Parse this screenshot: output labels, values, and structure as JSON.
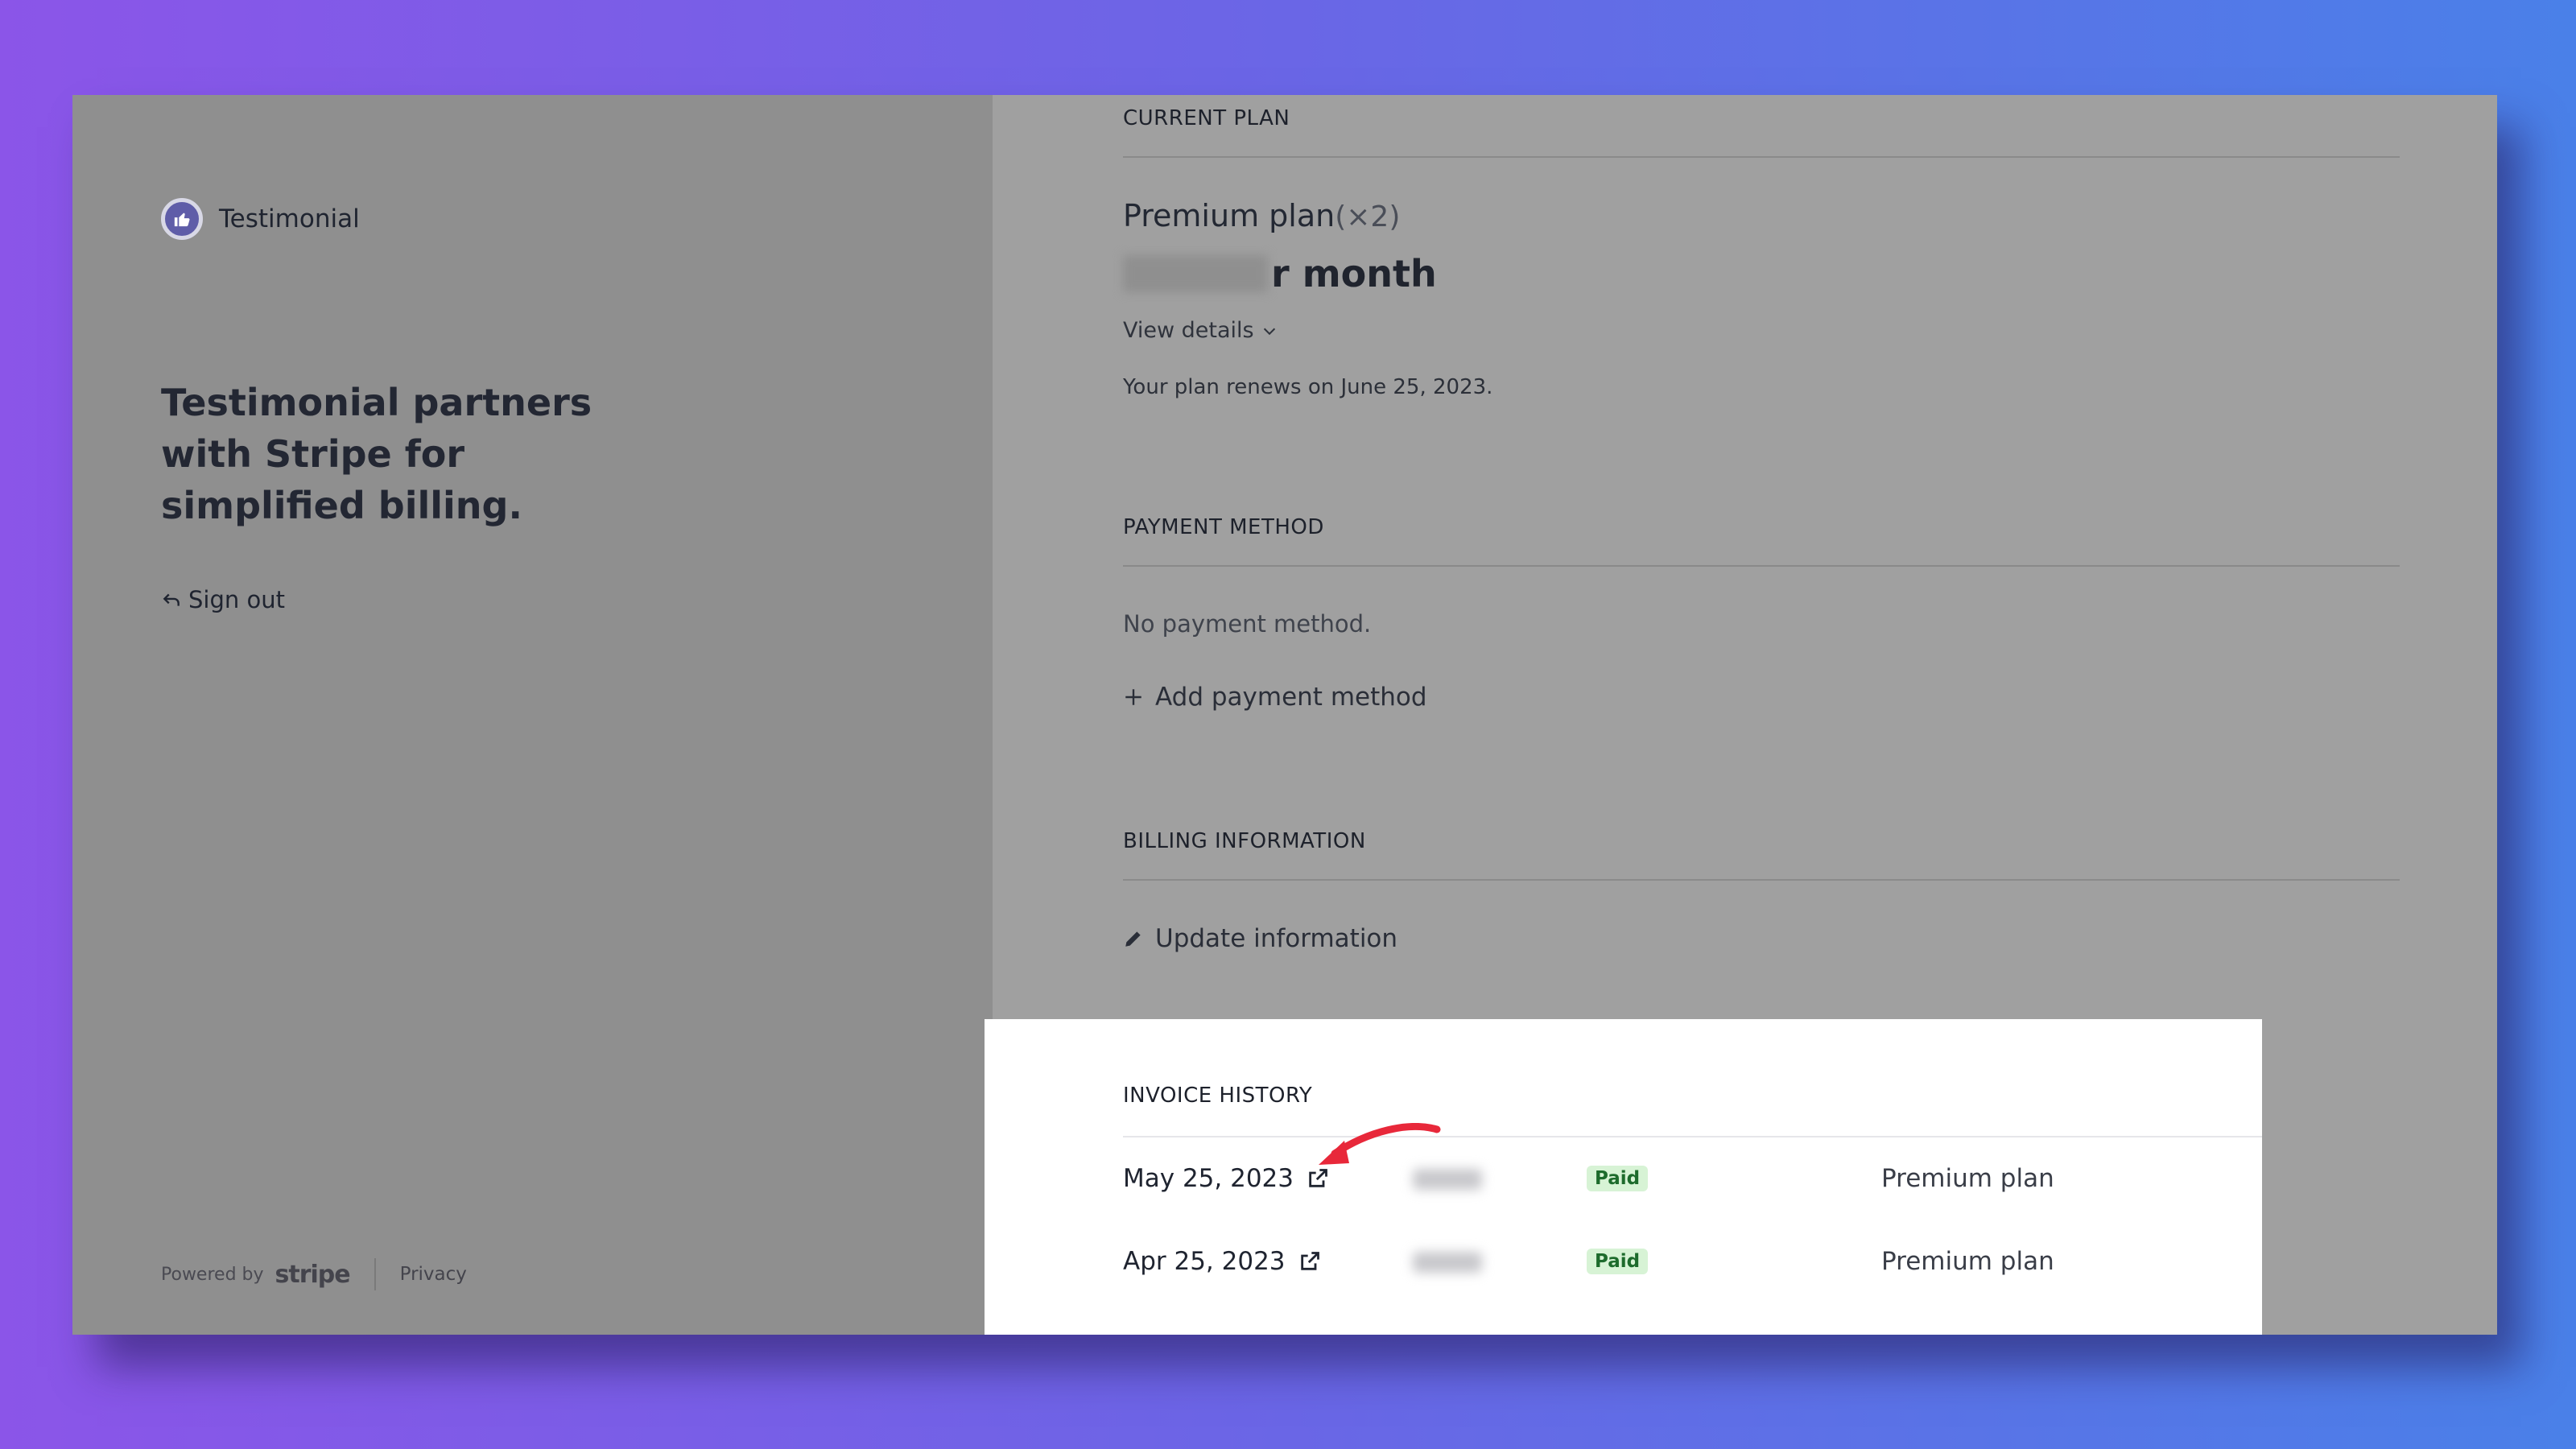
{
  "brand": {
    "name": "Testimonial"
  },
  "left": {
    "tagline": "Testimonial partners with Stripe for simplified billing.",
    "signout_label": "Sign out",
    "footer": {
      "powered_by": "Powered by",
      "stripe": "stripe",
      "privacy": "Privacy"
    }
  },
  "current_plan": {
    "section_title": "CURRENT PLAN",
    "plan_name": "Premium plan",
    "quantity": "(×2)",
    "price_suffix": "r month",
    "view_details": "View details",
    "renews_text": "Your plan renews on June 25, 2023."
  },
  "payment_method": {
    "section_title": "PAYMENT METHOD",
    "empty_text": "No payment method.",
    "add_label": "Add payment method"
  },
  "billing_information": {
    "section_title": "BILLING INFORMATION",
    "update_label": "Update information"
  },
  "invoice_history": {
    "section_title": "INVOICE HISTORY",
    "rows": [
      {
        "date": "May 25, 2023",
        "status": "Paid",
        "plan": "Premium plan"
      },
      {
        "date": "Apr 25, 2023",
        "status": "Paid",
        "plan": "Premium plan"
      }
    ]
  },
  "colors": {
    "arrow": "#e8283a",
    "brand_logo": "#5f5da8",
    "paid_badge_bg": "#d7f3d5"
  },
  "icons": [
    "thumbs-up-icon",
    "sign-out-arrow-icon",
    "chevron-down-icon",
    "plus-icon",
    "pencil-icon",
    "external-link-icon"
  ]
}
